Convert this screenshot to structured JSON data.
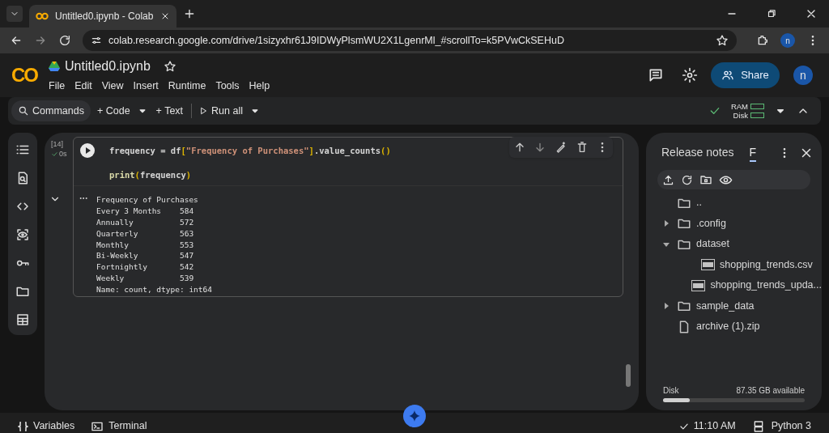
{
  "browser": {
    "tab_title": "Untitled0.ipynb - Colab",
    "url": "colab.research.google.com/drive/1sizyxhr61J9IDWyPlsmWU2X1LgenrMl_#scrollTo=k5PVwCkSEHuD",
    "profile": "n"
  },
  "header": {
    "logo": "CO",
    "title": "Untitled0.ipynb",
    "menu": [
      "File",
      "Edit",
      "View",
      "Insert",
      "Runtime",
      "Tools",
      "Help"
    ],
    "share": "Share",
    "avatar": "n"
  },
  "toolbar": {
    "commands": "Commands",
    "code": "+ Code",
    "text": "+ Text",
    "run_all": "Run all",
    "ram": "RAM",
    "disk": "Disk"
  },
  "cell": {
    "exec_count": "[14]",
    "duration": "0s",
    "code": [
      [
        {
          "t": "frequency = df",
          "color": "#d4d4d4"
        },
        {
          "t": "[",
          "color": "#dcb400"
        },
        {
          "t": "\"Frequency of Purchases\"",
          "color": "#ce9178"
        },
        {
          "t": "]",
          "color": "#dcb400"
        },
        {
          "t": ".value_counts",
          "color": "#d4d4d4"
        },
        {
          "t": "()",
          "color": "#dcb400"
        }
      ],
      [
        {
          "t": "print",
          "color": "#dcdcaa"
        },
        {
          "t": "(",
          "color": "#dcb400"
        },
        {
          "t": "frequency",
          "color": "#d4d4d4"
        },
        {
          "t": ")",
          "color": "#dcb400"
        }
      ]
    ],
    "output": [
      "Frequency of Purchases",
      "Every 3 Months    584",
      "Annually          572",
      "Quarterly         563",
      "Monthly           553",
      "Bi-Weekly         547",
      "Fortnightly       542",
      "Weekly            539",
      "Name: count, dtype: int64"
    ]
  },
  "files_panel": {
    "tabs": [
      {
        "label": "Release notes",
        "selected": false
      },
      {
        "label": "F",
        "selected": true
      }
    ],
    "tree": [
      {
        "name": "..",
        "kind": "folder"
      },
      {
        "name": ".config",
        "kind": "folder",
        "expanded": false
      },
      {
        "name": "dataset",
        "kind": "folder",
        "expanded": true,
        "children": [
          {
            "name": "shopping_trends.csv",
            "kind": "csv"
          },
          {
            "name": "shopping_trends_upda...",
            "kind": "csv"
          }
        ]
      },
      {
        "name": "sample_data",
        "kind": "folder",
        "expanded": false
      },
      {
        "name": "archive (1).zip",
        "kind": "file"
      }
    ],
    "disk": {
      "label": "Disk",
      "available": "87.35 GB available",
      "level": 0.19
    }
  },
  "status_bar": {
    "variables": "Variables",
    "terminal": "Terminal",
    "time": "11:10 AM",
    "runtime": "Python 3"
  }
}
